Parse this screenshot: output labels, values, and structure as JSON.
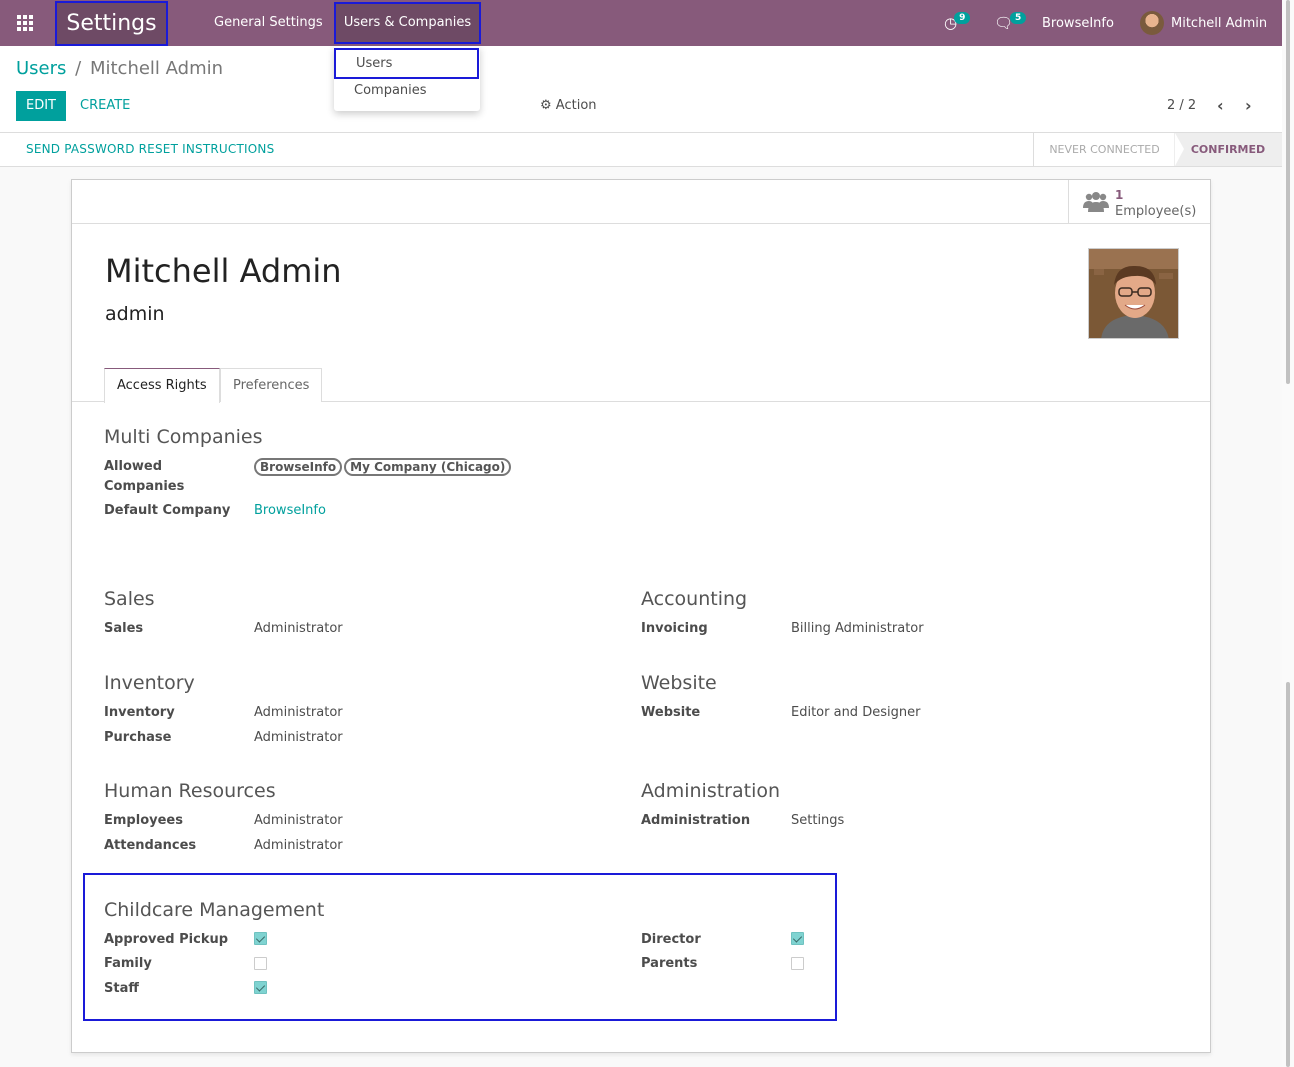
{
  "navbar": {
    "brand": "Settings",
    "menu": [
      "General Settings",
      "Users & Companies"
    ],
    "activities_count": "9",
    "messages_count": "5",
    "company": "BrowseInfo",
    "user": "Mitchell Admin",
    "color": "#875a7b"
  },
  "dropdown": {
    "items": [
      "Users",
      "Companies"
    ]
  },
  "breadcrumb": {
    "parent": "Users",
    "separator": "/",
    "current": "Mitchell Admin"
  },
  "buttons": {
    "edit": "EDIT",
    "create": "CREATE",
    "action": "Action"
  },
  "pager": {
    "value": "2 / 2"
  },
  "statusbar": {
    "reset": "SEND PASSWORD RESET INSTRUCTIONS",
    "states": [
      "NEVER CONNECTED",
      "CONFIRMED"
    ],
    "active_state": "CONFIRMED"
  },
  "stat_button": {
    "value": "1",
    "text": "Employee(s)"
  },
  "user": {
    "name": "Mitchell Admin",
    "login": "admin"
  },
  "tabs": [
    "Access Rights",
    "Preferences"
  ],
  "multi_companies": {
    "title": "Multi Companies",
    "allowed_label_1": "Allowed",
    "allowed_label_2": "Companies",
    "allowed_tags": [
      "BrowseInfo",
      "My Company (Chicago)"
    ],
    "default_label": "Default Company",
    "default_value": "BrowseInfo"
  },
  "groups": {
    "sales": {
      "title": "Sales",
      "rows": [
        {
          "label": "Sales",
          "value": "Administrator"
        }
      ]
    },
    "accounting": {
      "title": "Accounting",
      "rows": [
        {
          "label": "Invoicing",
          "value": "Billing Administrator"
        }
      ]
    },
    "inventory": {
      "title": "Inventory",
      "rows": [
        {
          "label": "Inventory",
          "value": "Administrator"
        },
        {
          "label": "Purchase",
          "value": "Administrator"
        }
      ]
    },
    "website": {
      "title": "Website",
      "rows": [
        {
          "label": "Website",
          "value": "Editor and Designer"
        }
      ]
    },
    "hr": {
      "title": "Human Resources",
      "rows": [
        {
          "label": "Employees",
          "value": "Administrator"
        },
        {
          "label": "Attendances",
          "value": "Administrator"
        }
      ]
    },
    "administration": {
      "title": "Administration",
      "rows": [
        {
          "label": "Administration",
          "value": "Settings"
        }
      ]
    }
  },
  "childcare": {
    "title": "Childcare Management",
    "left": [
      {
        "label": "Approved Pickup",
        "checked": true
      },
      {
        "label": "Family",
        "checked": false
      },
      {
        "label": "Staff",
        "checked": true
      }
    ],
    "right": [
      {
        "label": "Director",
        "checked": true
      },
      {
        "label": "Parents",
        "checked": false
      }
    ]
  },
  "colors": {
    "accent": "#00a09d",
    "brand": "#875a7b",
    "highlight": "#1a1ad8"
  }
}
